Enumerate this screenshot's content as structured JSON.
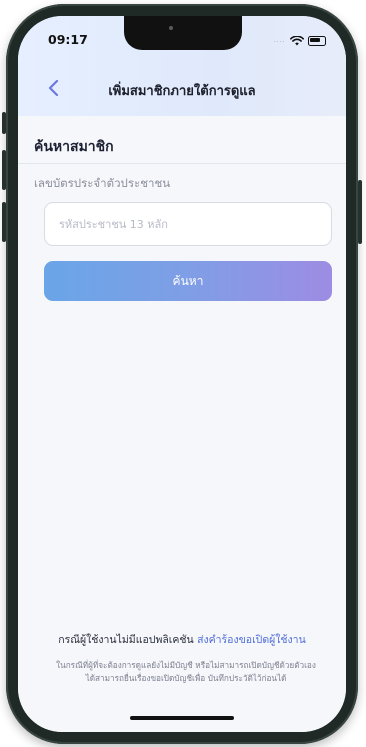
{
  "status_bar": {
    "time": "09:17",
    "signal_dots": "...."
  },
  "header": {
    "title": "เพิ่มสมาชิกภายใต้การดูแล"
  },
  "search_section": {
    "title": "ค้นหาสมาชิก",
    "field_label": "เลขบัตรประจำตัวประชาชน",
    "input_placeholder": "รหัสประชาชน 13 หลัก",
    "input_value": "",
    "button_label": "ค้นหา"
  },
  "footer": {
    "prompt": "กรณีผู้ใช้งานไม่มีแอปพลิเคชัน",
    "link_label": "ส่งคำร้องขอเปิดผู้ใช้งาน",
    "note": "ในกรณีที่ผู้ที่จะต้องการดูแลยังไม่มีบัญชี หรือไม่สามารถเปิดบัญชีด้วยตัวเองได้สามารถยื่นเรื่องขอเปิดบัญชีเพื่อ บันทึกประวัติไว้ก่อนได้"
  },
  "colors": {
    "accent_link": "#4f6ed9",
    "button_gradient_start": "#6aa5e8",
    "button_gradient_end": "#9d8ce3",
    "back_chevron": "#6b7ae0"
  },
  "icons": {
    "back": "chevron-left-icon",
    "wifi": "wifi-icon",
    "battery": "battery-icon"
  }
}
